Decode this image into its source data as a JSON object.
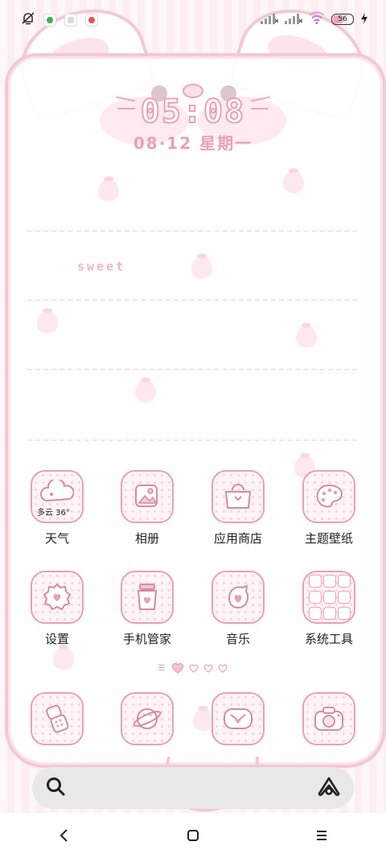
{
  "status_bar": {
    "battery": "56",
    "icons": [
      "mute-bell-icon",
      "wechat-icon",
      "notes-icon",
      "app-store-icon",
      "signal-icon",
      "signal-icon",
      "wifi-icon",
      "battery-icon",
      "charging-icon"
    ]
  },
  "clock": {
    "time": "05:08",
    "date": "08·12 星期一"
  },
  "decor": {
    "sweet": "sweet"
  },
  "apps_row1": [
    {
      "label": "天气",
      "icon": "weather-icon",
      "weather": "多云 36°"
    },
    {
      "label": "相册",
      "icon": "gallery-icon"
    },
    {
      "label": "应用商店",
      "icon": "app-store-icon"
    },
    {
      "label": "主题壁纸",
      "icon": "palette-icon"
    }
  ],
  "apps_row2": [
    {
      "label": "设置",
      "icon": "settings-icon"
    },
    {
      "label": "手机管家",
      "icon": "security-jar-icon"
    },
    {
      "label": "音乐",
      "icon": "music-icon"
    },
    {
      "label": "系统工具",
      "icon": "system-tools-folder-icon"
    }
  ],
  "dock": [
    {
      "icon": "phone-icon"
    },
    {
      "icon": "browser-planet-icon"
    },
    {
      "icon": "messages-icon"
    },
    {
      "icon": "camera-icon"
    }
  ],
  "search": {
    "placeholder": ""
  },
  "colors": {
    "accent": "#e9a0b5",
    "accent_light": "#fde3ea",
    "text": "#222222"
  }
}
